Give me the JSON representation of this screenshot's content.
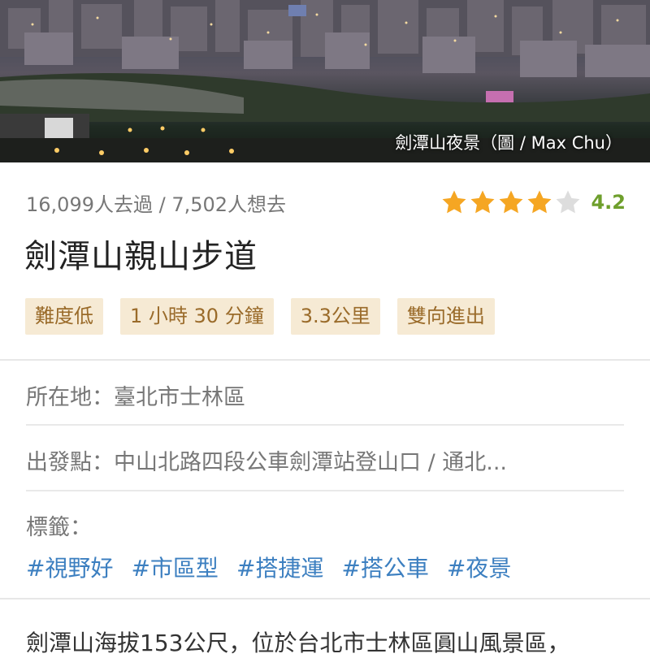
{
  "hero": {
    "caption": "劍潭山夜景（圖 / Max Chu）"
  },
  "trail": {
    "stats": "16,099人去過 / 7,502人想去",
    "rating": "4.2",
    "rating_fraction": 0.84,
    "star_color": "#f5a623",
    "star_empty_color": "#dddddd",
    "title": "劍潭山親山步道",
    "chips": [
      "難度低",
      "1 小時 30 分鐘",
      "3.3公里",
      "雙向進出"
    ]
  },
  "info": {
    "location": "所在地：臺北市士林區",
    "start": "出發點：中山北路四段公車劍潭站登山口 / 通北...",
    "tags_label": "標籤：",
    "tags": [
      "#視野好",
      "#市區型",
      "#搭捷運",
      "#搭公車",
      "#夜景"
    ]
  },
  "description": "劍潭山海拔153公尺，位於台北市士林區圓山風景區，"
}
